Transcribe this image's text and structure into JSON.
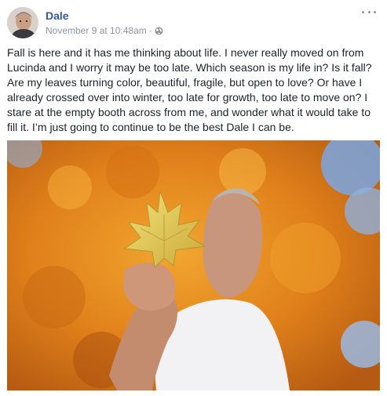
{
  "post": {
    "author": "Dale",
    "timestamp": "November 9 at 10:48am",
    "separator": "·",
    "audience_icon": "globe-icon",
    "menu_icon": "more-options-icon",
    "text": "Fall is here and it has me thinking about life. I never really moved on from Lucinda and I worry it may be too late. Which season is my life in? Is it fall? Are my leaves turning color, beautiful, fragile, but open to love? Or have I already crossed over into winter, too late for growth, too late to move on? I stare at the empty booth across from me, and wonder what it would take to fill it. I’m just going to continue to be the best Dale I can be.",
    "colors": {
      "author": "#365899",
      "meta": "#90949c",
      "text": "#1d2129",
      "foliage": "#e8901a",
      "sky": "#7fa3d6"
    }
  }
}
